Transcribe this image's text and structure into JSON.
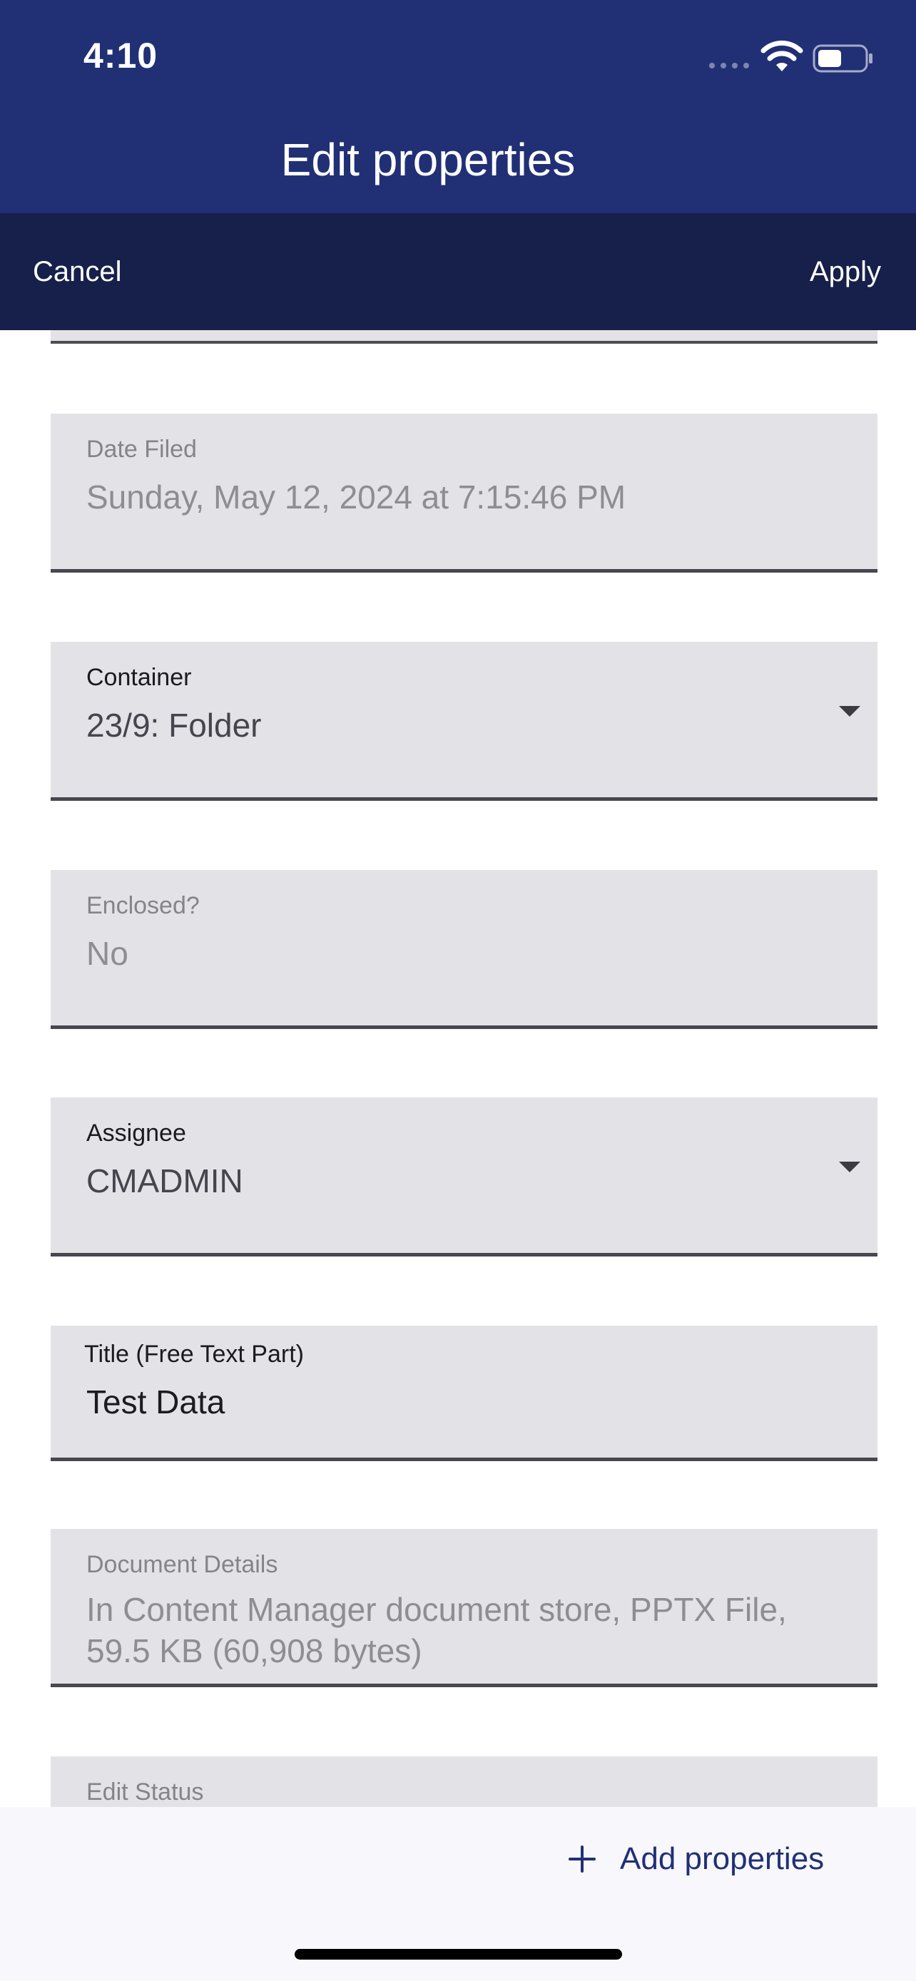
{
  "status_bar": {
    "time": "4:10",
    "icons": [
      "signal-dots-icon",
      "wifi-icon",
      "battery-icon"
    ]
  },
  "header": {
    "title": "Edit properties",
    "background_color": "#213075"
  },
  "action_bar": {
    "cancel_label": "Cancel",
    "apply_label": "Apply",
    "background_color": "#16204a"
  },
  "fields": [
    {
      "label": "Date Filed",
      "value": "Sunday, May 12, 2024 at 7:15:46 PM",
      "editable": false,
      "dropdown": false
    },
    {
      "label": "Container",
      "value": "23/9: Folder",
      "editable": true,
      "dropdown": true
    },
    {
      "label": "Enclosed?",
      "value": "No",
      "editable": false,
      "dropdown": false
    },
    {
      "label": "Assignee",
      "value": "CMADMIN",
      "editable": true,
      "dropdown": true
    },
    {
      "label": "Title (Free Text Part)",
      "value": "Test Data",
      "editable": true,
      "dropdown": false
    },
    {
      "label": "Document Details",
      "value": "In Content Manager document store, PPTX File, 59.5 KB (60,908 bytes)",
      "editable": false,
      "dropdown": false
    },
    {
      "label": "Edit Status",
      "value": "",
      "editable": false,
      "dropdown": false
    }
  ],
  "bottom_bar": {
    "add_properties_label": "Add properties",
    "accent_color": "#213075"
  }
}
